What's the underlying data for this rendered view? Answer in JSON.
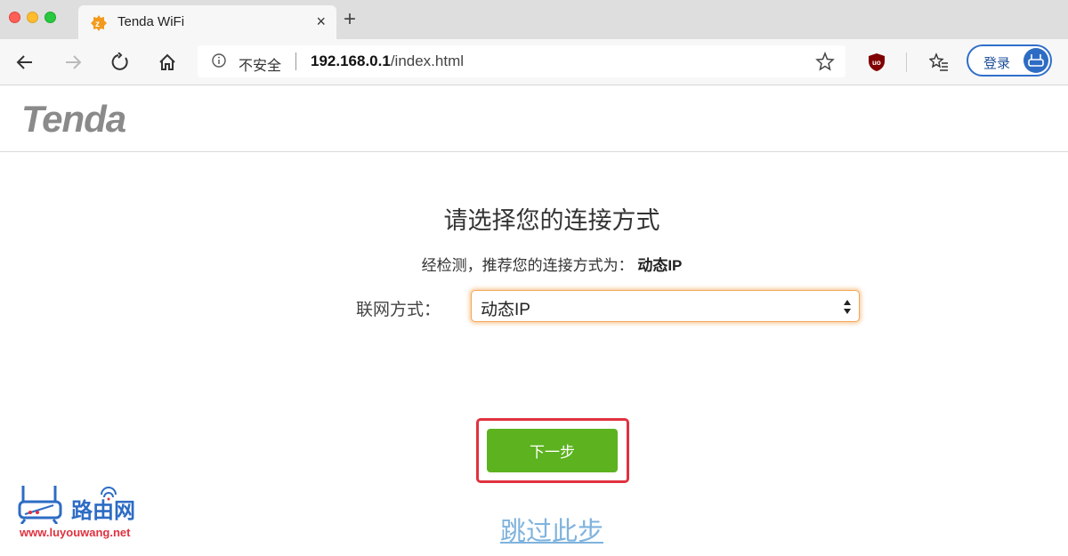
{
  "browser": {
    "tab_title": "Tenda WiFi",
    "tab_close": "×",
    "new_tab": "+",
    "address_insecure": "不安全",
    "address_host": "192.168.0.1",
    "address_path": "/index.html",
    "login_label": "登录"
  },
  "page": {
    "logo": "Tenda",
    "title": "请选择您的连接方式",
    "recommend_prefix": "经检测，推荐您的连接方式为：",
    "recommend_value": "动态IP",
    "connection_label": "联网方式：",
    "connection_selected": "动态IP",
    "next_button": "下一步",
    "skip_link": "跳过此步"
  },
  "watermark": {
    "name": "路由网",
    "url": "www.luyouwang.net"
  },
  "colors": {
    "next_button": "#5cb21f",
    "highlight": "#e0323f",
    "skip_link": "#7fb3dd",
    "select_focus": "#f0a85a"
  }
}
